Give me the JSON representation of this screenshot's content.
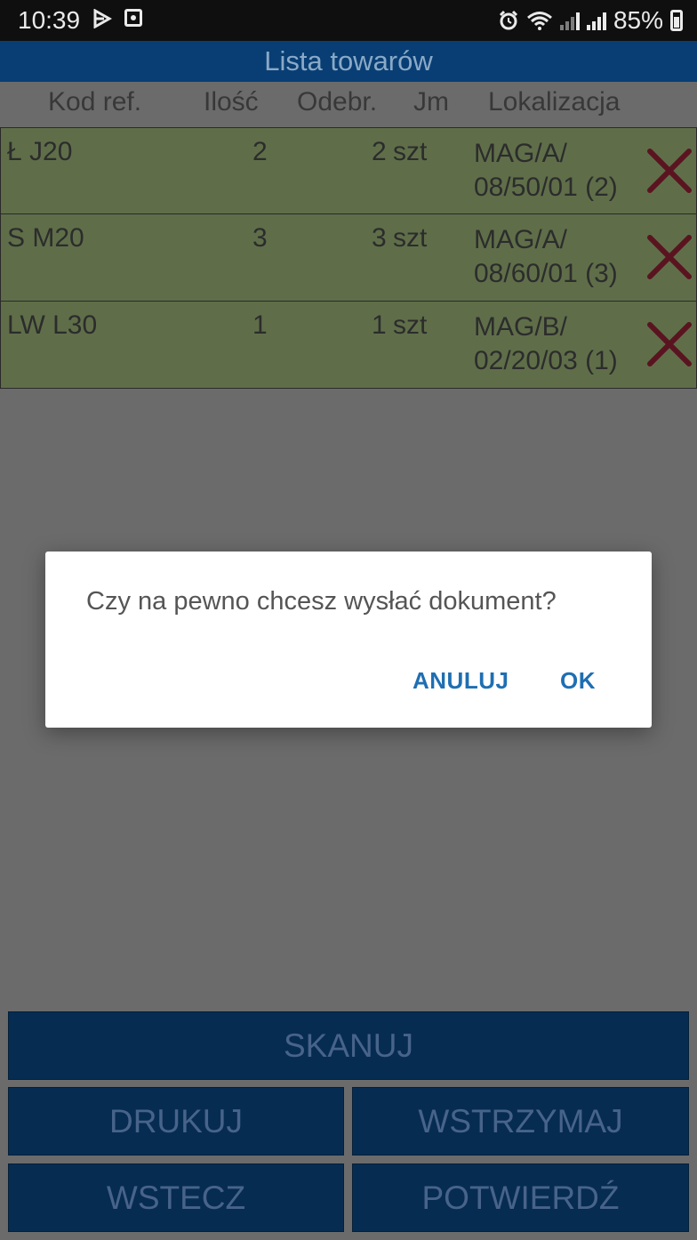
{
  "status_bar": {
    "time": "10:39",
    "battery": "85%",
    "icons": [
      "play-store-icon",
      "app-notification-icon",
      "alarm-icon",
      "wifi-icon",
      "signal-icon",
      "signal-icon",
      "battery-charging-icon"
    ]
  },
  "app": {
    "title": "Lista towarów",
    "columns": {
      "kod": "Kod ref.",
      "ilosc": "Ilość",
      "odebr": "Odebr.",
      "jm": "Jm",
      "lokalizacja": "Lokalizacja"
    },
    "rows": [
      {
        "kod": "Ł J20",
        "ilosc": "2",
        "odebr": "2",
        "jm": "szt",
        "lok1": "MAG/A/",
        "lok2": "08/50/01 (2)"
      },
      {
        "kod": "S M20",
        "ilosc": "3",
        "odebr": "3",
        "jm": "szt",
        "lok1": "MAG/A/",
        "lok2": "08/60/01 (3)"
      },
      {
        "kod": "LW L30",
        "ilosc": "1",
        "odebr": "1",
        "jm": "szt",
        "lok1": "MAG/B/",
        "lok2": "02/20/03 (1)"
      }
    ],
    "buttons": {
      "skanuj": "SKANUJ",
      "drukuj": "DRUKUJ",
      "wstrzymaj": "WSTRZYMAJ",
      "wstecz": "WSTECZ",
      "potwierdz": "POTWIERDŹ"
    }
  },
  "dialog": {
    "message": "Czy na pewno chcesz wysłać dokument?",
    "cancel": "ANULUJ",
    "ok": "OK"
  },
  "colors": {
    "app_bar": "#0d5ea9",
    "row_background": "#9dba6e",
    "delete_icon": "#b81f3a",
    "dialog_button": "#1f6fb2"
  }
}
